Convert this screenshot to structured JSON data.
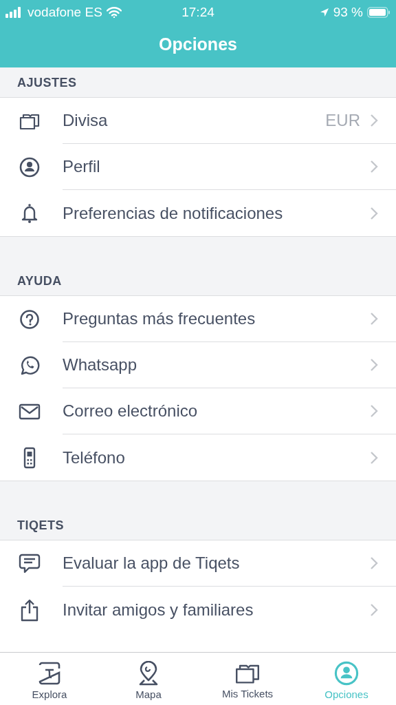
{
  "status_bar": {
    "carrier": "vodafone ES",
    "time": "17:24",
    "battery": "93 %"
  },
  "header": {
    "title": "Opciones"
  },
  "sections": [
    {
      "title": "AJUSTES",
      "items": [
        {
          "label": "Divisa",
          "value": "EUR"
        },
        {
          "label": "Perfil"
        },
        {
          "label": "Preferencias de notificaciones"
        }
      ]
    },
    {
      "title": "AYUDA",
      "items": [
        {
          "label": "Preguntas más frecuentes"
        },
        {
          "label": "Whatsapp"
        },
        {
          "label": "Correo electrónico"
        },
        {
          "label": "Teléfono"
        }
      ]
    },
    {
      "title": "TIQETS",
      "items": [
        {
          "label": "Evaluar la app de Tiqets"
        },
        {
          "label": "Invitar amigos y familiares"
        }
      ]
    }
  ],
  "tab_bar": [
    {
      "label": "Explora",
      "selected": false
    },
    {
      "label": "Mapa",
      "selected": false
    },
    {
      "label": "Mis Tickets",
      "selected": false
    },
    {
      "label": "Opciones",
      "selected": true
    }
  ]
}
